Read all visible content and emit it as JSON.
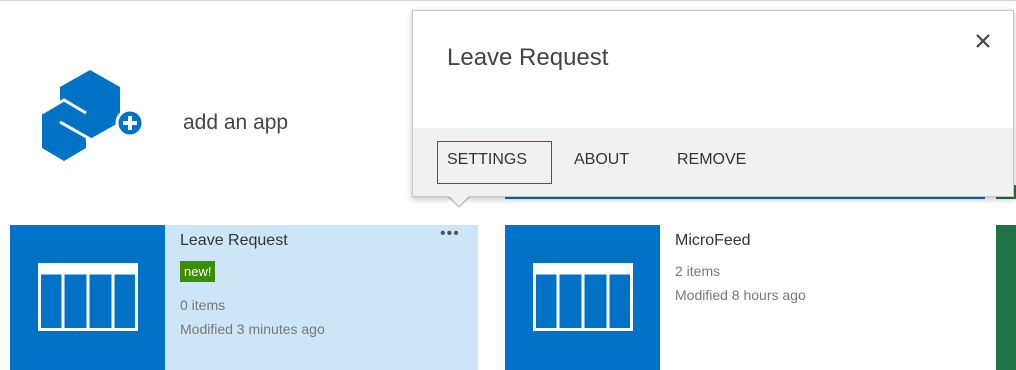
{
  "add_app": {
    "label": "add an app",
    "icon": "add-app-hexagon-icon"
  },
  "tiles": [
    {
      "title": "Leave Request",
      "badge": "new!",
      "items": "0 items",
      "modified": "Modified 3 minutes ago",
      "more": "•••",
      "icon": "list-table-icon"
    },
    {
      "title": "MicroFeed",
      "items": "2 items",
      "modified": "Modified 8 hours ago",
      "icon": "list-table-icon"
    }
  ],
  "callout": {
    "title": "Leave Request",
    "close_icon": "close-icon",
    "actions": {
      "settings": "SETTINGS",
      "about": "ABOUT",
      "remove": "REMOVE"
    }
  },
  "colors": {
    "tile_blue": "#0072c6",
    "selected_tile_bg": "#cde6f7",
    "new_badge": "#3a8e00",
    "highlight_red": "#e81123",
    "strip_green": "#217346"
  }
}
